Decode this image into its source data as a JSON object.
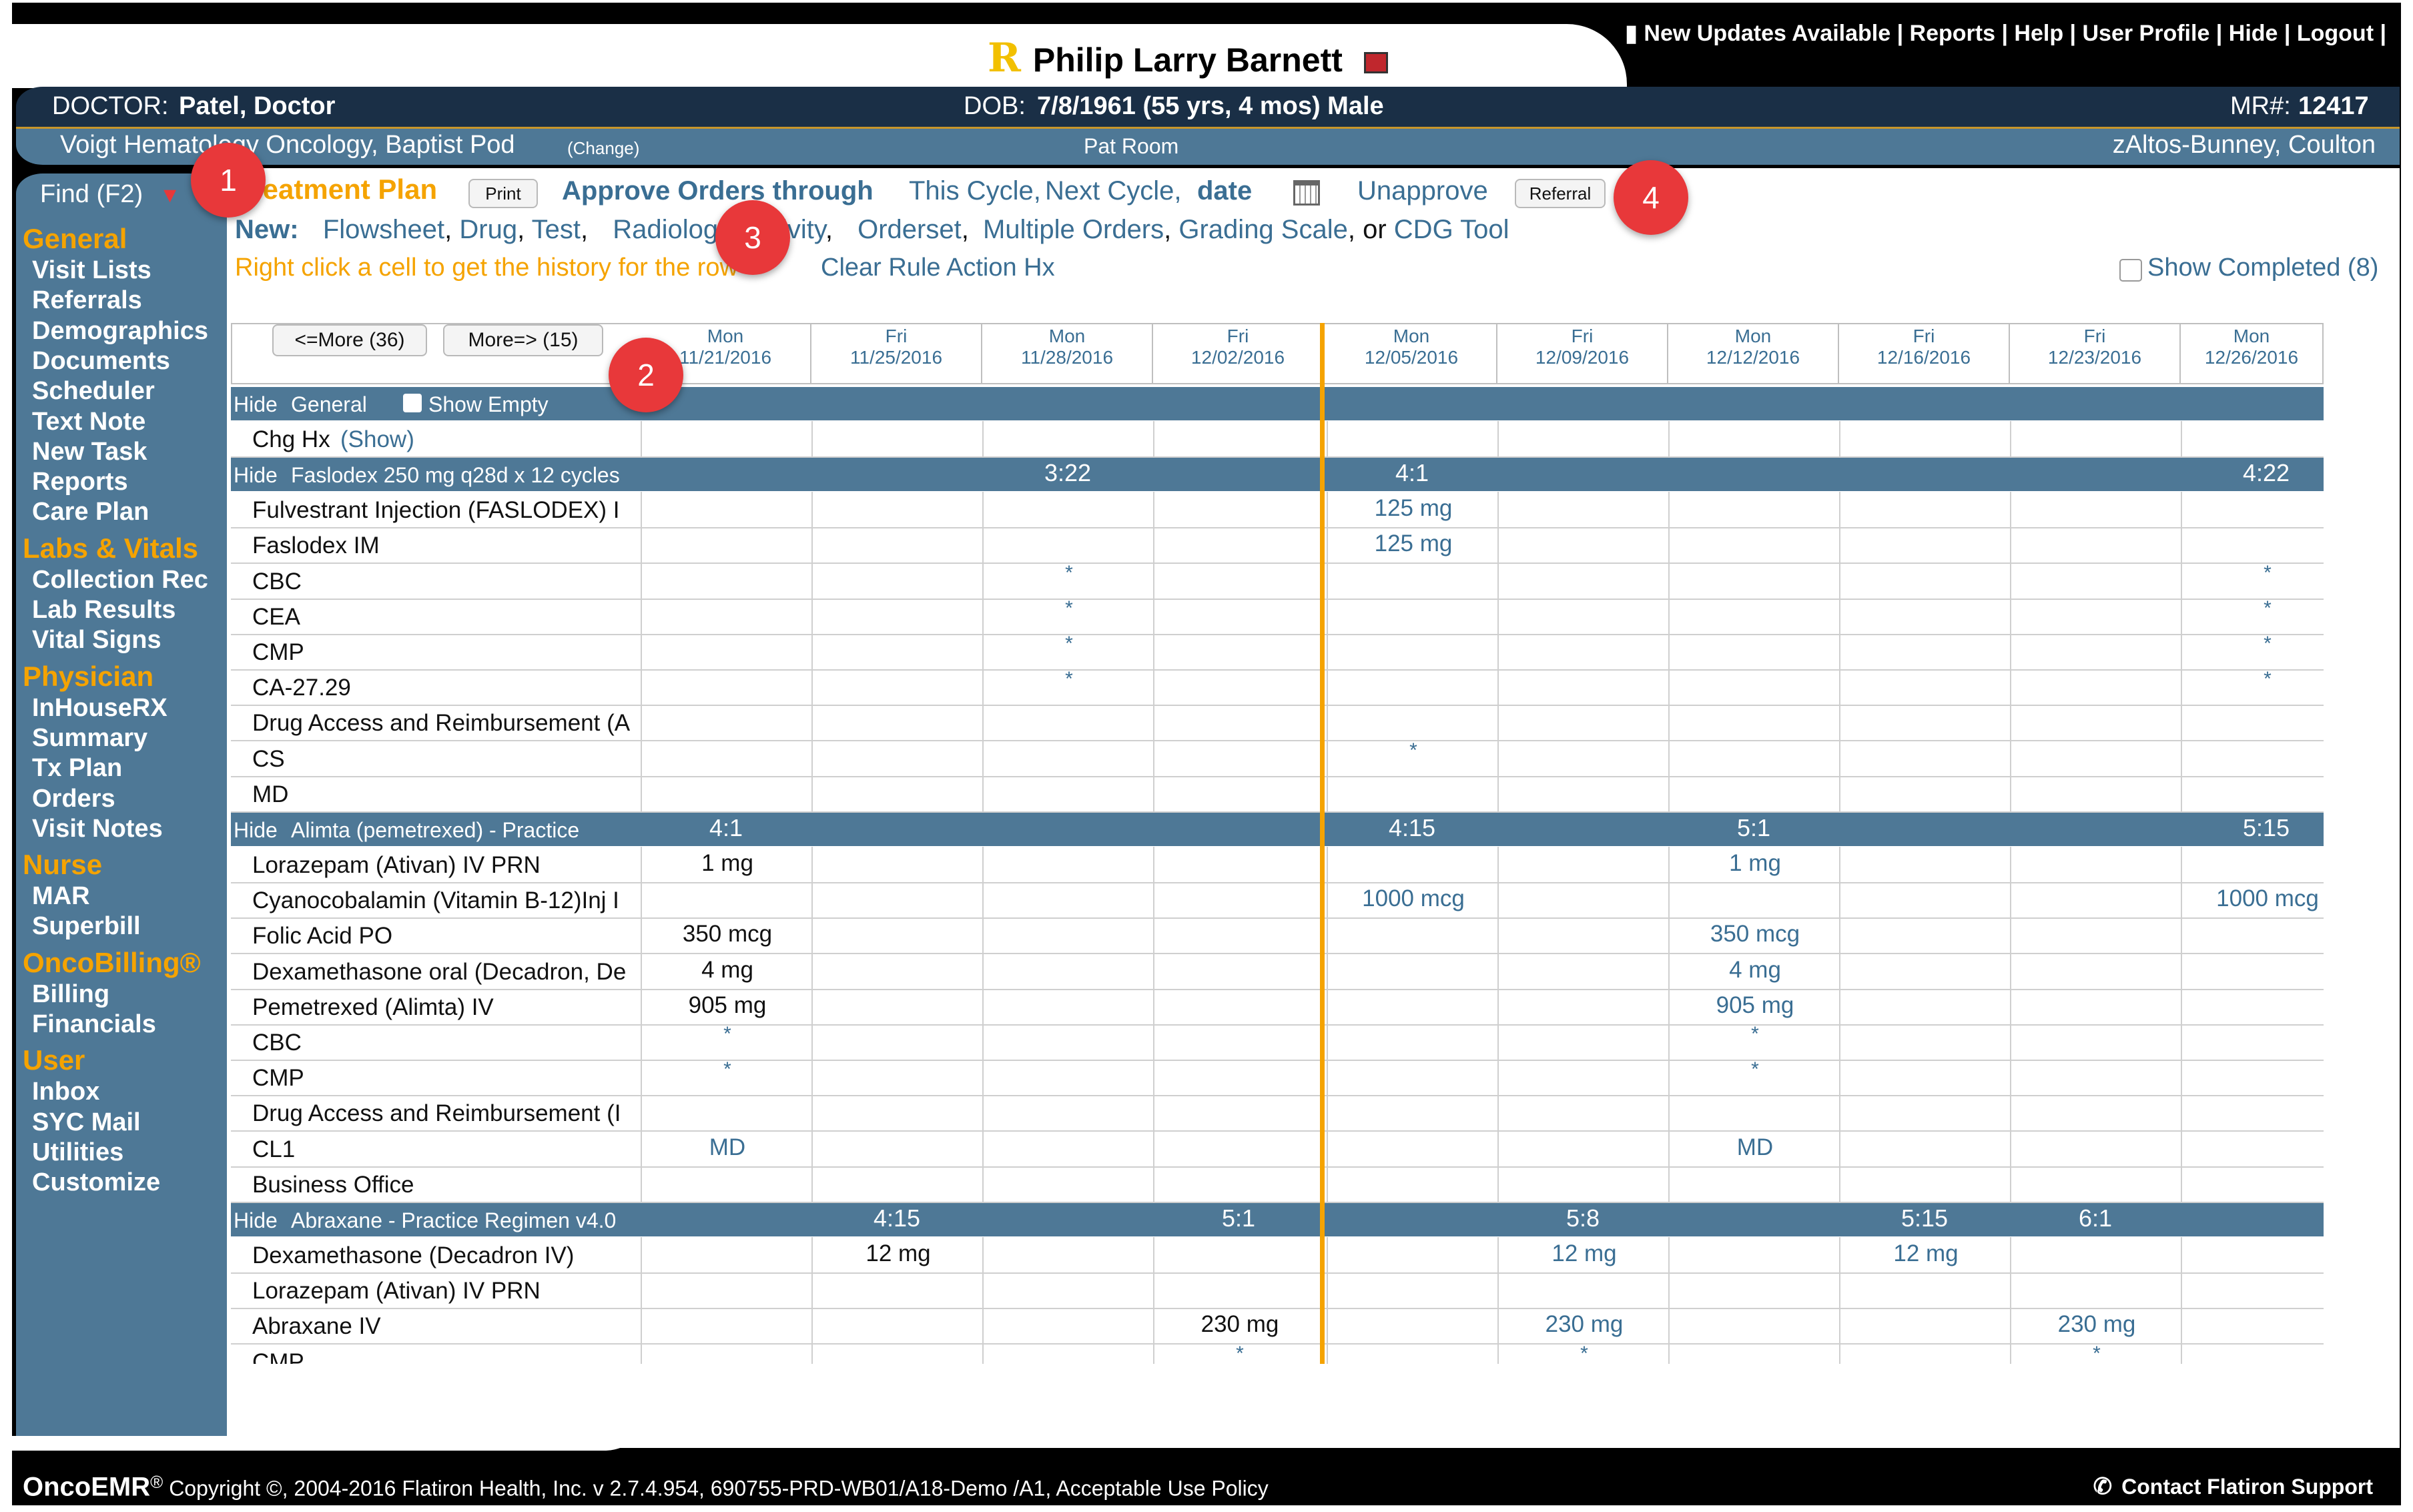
{
  "top_links": [
    "New Updates Available",
    "Reports",
    "Help",
    "User Profile",
    "Hide",
    "Logout"
  ],
  "patient": {
    "name": "Philip Larry Barnett",
    "logo_letter": "R"
  },
  "header": {
    "doctor_label": "DOCTOR:",
    "doctor": "Patel, Doctor",
    "dob_label": "DOB:",
    "dob": "7/8/1961 (55 yrs, 4 mos) Male",
    "mr_label": "MR#:",
    "mr": "12417",
    "location": "Voigt Hematology Oncology, Baptist Pod",
    "change": "(Change)",
    "room": "Pat Room",
    "provider": "zAltos-Bunney, Coulton"
  },
  "find": "Find (F2)",
  "sidebar": [
    {
      "heading": "General",
      "items": [
        "Visit Lists",
        "Referrals",
        "Demographics",
        "Documents",
        "Scheduler",
        "Text Note",
        "New Task",
        "Reports",
        "Care Plan"
      ]
    },
    {
      "heading": "Labs & Vitals",
      "items": [
        "Collection Rec",
        "Lab Results",
        "Vital Signs"
      ]
    },
    {
      "heading": "Physician",
      "items": [
        "InHouseRX",
        "Summary",
        "Tx Plan",
        "Orders",
        "Visit Notes"
      ]
    },
    {
      "heading": "Nurse",
      "items": [
        "MAR",
        "Superbill"
      ]
    },
    {
      "heading": "OncoBilling®",
      "items": [
        "Billing",
        "Financials"
      ]
    },
    {
      "heading": "User",
      "items": [
        "Inbox",
        "SYC Mail",
        "Utilities",
        "Customize"
      ]
    }
  ],
  "toolbar": {
    "title": "Treatment Plan",
    "print": "Print",
    "approve": "Approve Orders through",
    "this_cycle": "This Cycle,",
    "next_cycle": "Next Cycle,",
    "date": "date",
    "unapprove": "Unapprove",
    "referral": "Referral",
    "new_label": "New:",
    "new_items": [
      "Flowsheet",
      "Drug",
      "Test",
      "Radiology",
      "Activity",
      "Orderset",
      "Multiple Orders",
      "Grading Scale",
      "CDG Tool"
    ],
    "or": "or",
    "hint": "Right click a cell to get the history for the row",
    "clear_hx": "Clear Rule Action Hx",
    "show_completed": "Show Completed (8)"
  },
  "grid": {
    "more_prev": "<=More (36)",
    "more_next": "More=> (15)",
    "dates": [
      {
        "day": "Mon",
        "date": "11/21/2016"
      },
      {
        "day": "Fri",
        "date": "11/25/2016"
      },
      {
        "day": "Mon",
        "date": "11/28/2016"
      },
      {
        "day": "Fri",
        "date": "12/02/2016"
      },
      {
        "day": "Mon",
        "date": "12/05/2016"
      },
      {
        "day": "Fri",
        "date": "12/09/2016"
      },
      {
        "day": "Mon",
        "date": "12/12/2016"
      },
      {
        "day": "Fri",
        "date": "12/16/2016"
      },
      {
        "day": "Fri",
        "date": "12/23/2016"
      },
      {
        "day": "Mon",
        "date": "12/26/2016"
      }
    ],
    "hide": "Hide",
    "show_empty": "Show Empty",
    "rows": [
      {
        "type": "section",
        "label": "General",
        "cells": [
          "",
          "",
          "",
          "",
          "",
          "",
          "",
          "",
          "",
          ""
        ]
      },
      {
        "type": "row",
        "label": "Chg Hx",
        "extra": "(Show)",
        "cells": [
          "",
          "",
          "",
          "",
          "",
          "",
          "",
          "",
          "",
          ""
        ]
      },
      {
        "type": "section",
        "label": "Faslodex 250 mg q28d x 12 cycles",
        "cells": [
          "",
          "",
          "3:22",
          "",
          "4:1",
          "",
          "",
          "",
          "",
          "4:22"
        ]
      },
      {
        "type": "row",
        "label": "Fulvestrant Injection (FASLODEX) I",
        "cells": [
          "",
          "",
          "",
          "",
          "125 mg",
          "",
          "",
          "",
          "",
          ""
        ]
      },
      {
        "type": "row",
        "label": "Faslodex IM",
        "cells": [
          "",
          "",
          "",
          "",
          "125 mg",
          "",
          "",
          "",
          "",
          ""
        ]
      },
      {
        "type": "row",
        "label": "CBC",
        "cells": [
          "",
          "",
          "*",
          "",
          "",
          "",
          "",
          "",
          "",
          "*"
        ]
      },
      {
        "type": "row",
        "label": "CEA",
        "cells": [
          "",
          "",
          "*",
          "",
          "",
          "",
          "",
          "",
          "",
          "*"
        ]
      },
      {
        "type": "row",
        "label": "CMP",
        "cells": [
          "",
          "",
          "*",
          "",
          "",
          "",
          "",
          "",
          "",
          "*"
        ]
      },
      {
        "type": "row",
        "label": "CA-27.29",
        "cells": [
          "",
          "",
          "*",
          "",
          "",
          "",
          "",
          "",
          "",
          "*"
        ]
      },
      {
        "type": "row",
        "label": "Drug Access and Reimbursement (A",
        "cells": [
          "",
          "",
          "",
          "",
          "",
          "",
          "",
          "",
          "",
          ""
        ]
      },
      {
        "type": "row",
        "label": "CS",
        "cells": [
          "",
          "",
          "",
          "",
          "*",
          "",
          "",
          "",
          "",
          ""
        ]
      },
      {
        "type": "row",
        "label": "MD",
        "cells": [
          "",
          "",
          "",
          "",
          "",
          "",
          "",
          "",
          "",
          ""
        ]
      },
      {
        "type": "section",
        "label": "Alimta (pemetrexed) - Practice",
        "cells": [
          "4:1",
          "",
          "",
          "",
          "4:15",
          "",
          "5:1",
          "",
          "",
          "5:15"
        ]
      },
      {
        "type": "row",
        "label": "Lorazepam (Ativan) IV PRN",
        "cells": [
          "1 mg",
          "",
          "",
          "",
          "",
          "",
          "1 mg",
          "",
          "",
          ""
        ]
      },
      {
        "type": "row",
        "label": "Cyanocobalamin (Vitamin B-12)Inj I",
        "cells": [
          "",
          "",
          "",
          "",
          "1000 mcg",
          "",
          "",
          "",
          "",
          "1000 mcg"
        ]
      },
      {
        "type": "row",
        "label": "Folic Acid PO",
        "cells": [
          "350 mcg",
          "",
          "",
          "",
          "",
          "",
          "350 mcg",
          "",
          "",
          ""
        ]
      },
      {
        "type": "row",
        "label": "Dexamethasone oral (Decadron, De",
        "cells": [
          "4 mg",
          "",
          "",
          "",
          "",
          "",
          "4 mg",
          "",
          "",
          ""
        ]
      },
      {
        "type": "row",
        "label": "Pemetrexed (Alimta) IV",
        "cells": [
          "905 mg",
          "",
          "",
          "",
          "",
          "",
          "905 mg",
          "",
          "",
          ""
        ]
      },
      {
        "type": "row",
        "label": "CBC",
        "cells": [
          "*",
          "",
          "",
          "",
          "",
          "",
          "*",
          "",
          "",
          ""
        ]
      },
      {
        "type": "row",
        "label": "CMP",
        "cells": [
          "*",
          "",
          "",
          "",
          "",
          "",
          "*",
          "",
          "",
          ""
        ]
      },
      {
        "type": "row",
        "label": "Drug Access and Reimbursement (I",
        "cells": [
          "",
          "",
          "",
          "",
          "",
          "",
          "",
          "",
          "",
          ""
        ]
      },
      {
        "type": "row",
        "label": "CL1",
        "cells": [
          "MD",
          "",
          "",
          "",
          "",
          "",
          "MD",
          "",
          "",
          ""
        ]
      },
      {
        "type": "row",
        "label": "Business Office",
        "cells": [
          "",
          "",
          "",
          "",
          "",
          "",
          "",
          "",
          "",
          ""
        ]
      },
      {
        "type": "section",
        "label": "Abraxane - Practice Regimen v4.0",
        "cells": [
          "",
          "4:15",
          "",
          "5:1",
          "",
          "5:8",
          "",
          "5:15",
          "6:1",
          ""
        ]
      },
      {
        "type": "row",
        "label": "Dexamethasone (Decadron IV)",
        "cells": [
          "",
          "12 mg",
          "",
          "",
          "",
          "12 mg",
          "",
          "12 mg",
          "",
          ""
        ]
      },
      {
        "type": "row",
        "label": "Lorazepam (Ativan) IV PRN",
        "cells": [
          "",
          "",
          "",
          "",
          "",
          "",
          "",
          "",
          "",
          ""
        ]
      },
      {
        "type": "row",
        "label": "Abraxane IV",
        "cells": [
          "",
          "",
          "",
          "230 mg",
          "",
          "230 mg",
          "",
          "",
          "230 mg",
          ""
        ]
      },
      {
        "type": "row",
        "label": "CMP",
        "cells": [
          "",
          "",
          "",
          "*",
          "",
          "*",
          "",
          "",
          "*",
          ""
        ]
      }
    ]
  },
  "badges": [
    "1",
    "2",
    "3",
    "4"
  ],
  "footer": {
    "brand": "OncoEMR",
    "reg": "®",
    "copyright": "Copyright ©, 2004-2016 Flatiron Health, Inc.   v 2.7.4.954, 690755-PRD-WB01/A18-Demo /A1, Acceptable Use Policy",
    "support": "Contact Flatiron Support"
  }
}
